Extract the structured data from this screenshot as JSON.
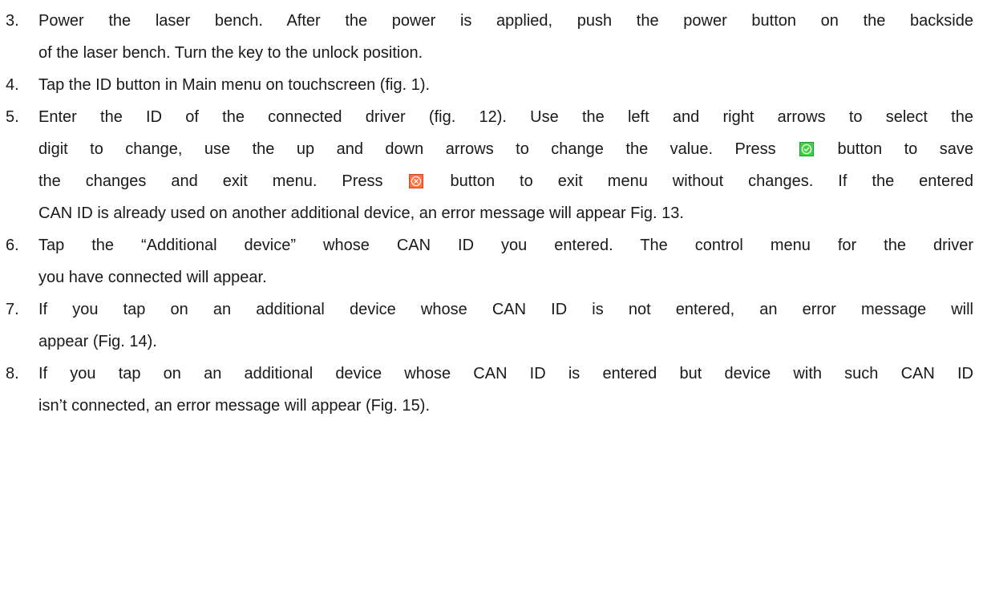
{
  "steps": [
    {
      "number": "3.",
      "lines": [
        "Power the laser bench. After the power is applied, push the power button on the backside",
        "of the laser bench. Turn the key to the unlock position."
      ]
    },
    {
      "number": "4.",
      "lines": [
        "Tap the ID button in Main menu on touchscreen (fig. 1)."
      ]
    },
    {
      "number": "5.",
      "lines": [
        "Enter the ID of the connected driver (fig. 12). Use the left and right arrows to select the",
        "digit to change, use the up and down arrows to change the value. Press",
        "button to save",
        "the changes and exit menu. Press",
        "button to exit menu without changes. If the entered",
        "CAN ID is already used on another additional device, an error message will appear Fig. 13."
      ]
    },
    {
      "number": "6.",
      "lines": [
        "Tap the “Additional device” whose CAN ID you entered. The control menu for the driver",
        "you have connected will appear."
      ]
    },
    {
      "number": "7.",
      "lines": [
        "If you tap on an additional device whose CAN ID is not entered, an error message will",
        "appear (Fig. 14)."
      ]
    },
    {
      "number": "8.",
      "lines": [
        "If you tap on an additional device whose CAN ID is entered but device with such CAN ID",
        "isn’t connected, an error message will appear (Fig. 15)."
      ]
    }
  ],
  "icons": {
    "confirm": "green-check-icon",
    "cancel": "red-x-icon"
  },
  "colors": {
    "confirm_bg": "#3fd13f",
    "cancel_bg": "#ff6f3c"
  }
}
